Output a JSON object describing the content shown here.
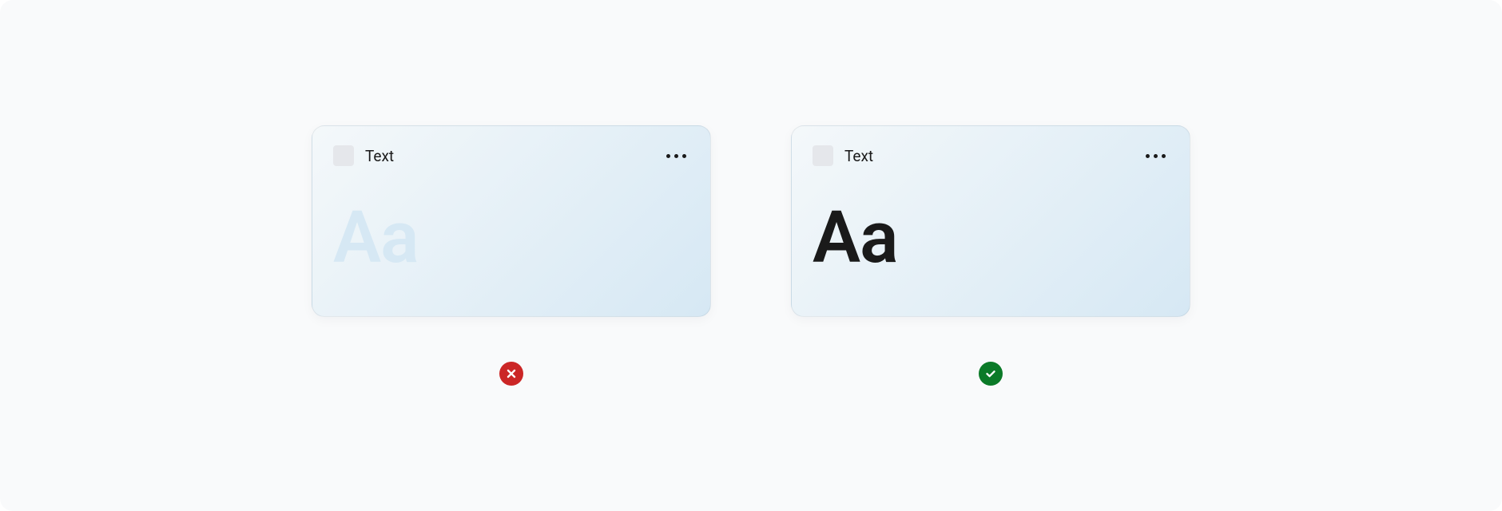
{
  "examples": {
    "dont": {
      "title": "Text",
      "sample": "Aa",
      "status": "dont",
      "colors": {
        "badge_bg": "#cb2626",
        "badge_fg": "#ffffff",
        "card_gradient_from": "#f4f8fa",
        "card_gradient_to": "#d6e8f4",
        "sample_color": "#d6e8f4"
      }
    },
    "do": {
      "title": "Text",
      "sample": "Aa",
      "status": "do",
      "colors": {
        "badge_bg": "#0b7a28",
        "badge_fg": "#ffffff",
        "card_gradient_from": "#f4f8fa",
        "card_gradient_to": "#d6e8f4",
        "sample_color": "#1a1a1a"
      }
    }
  }
}
